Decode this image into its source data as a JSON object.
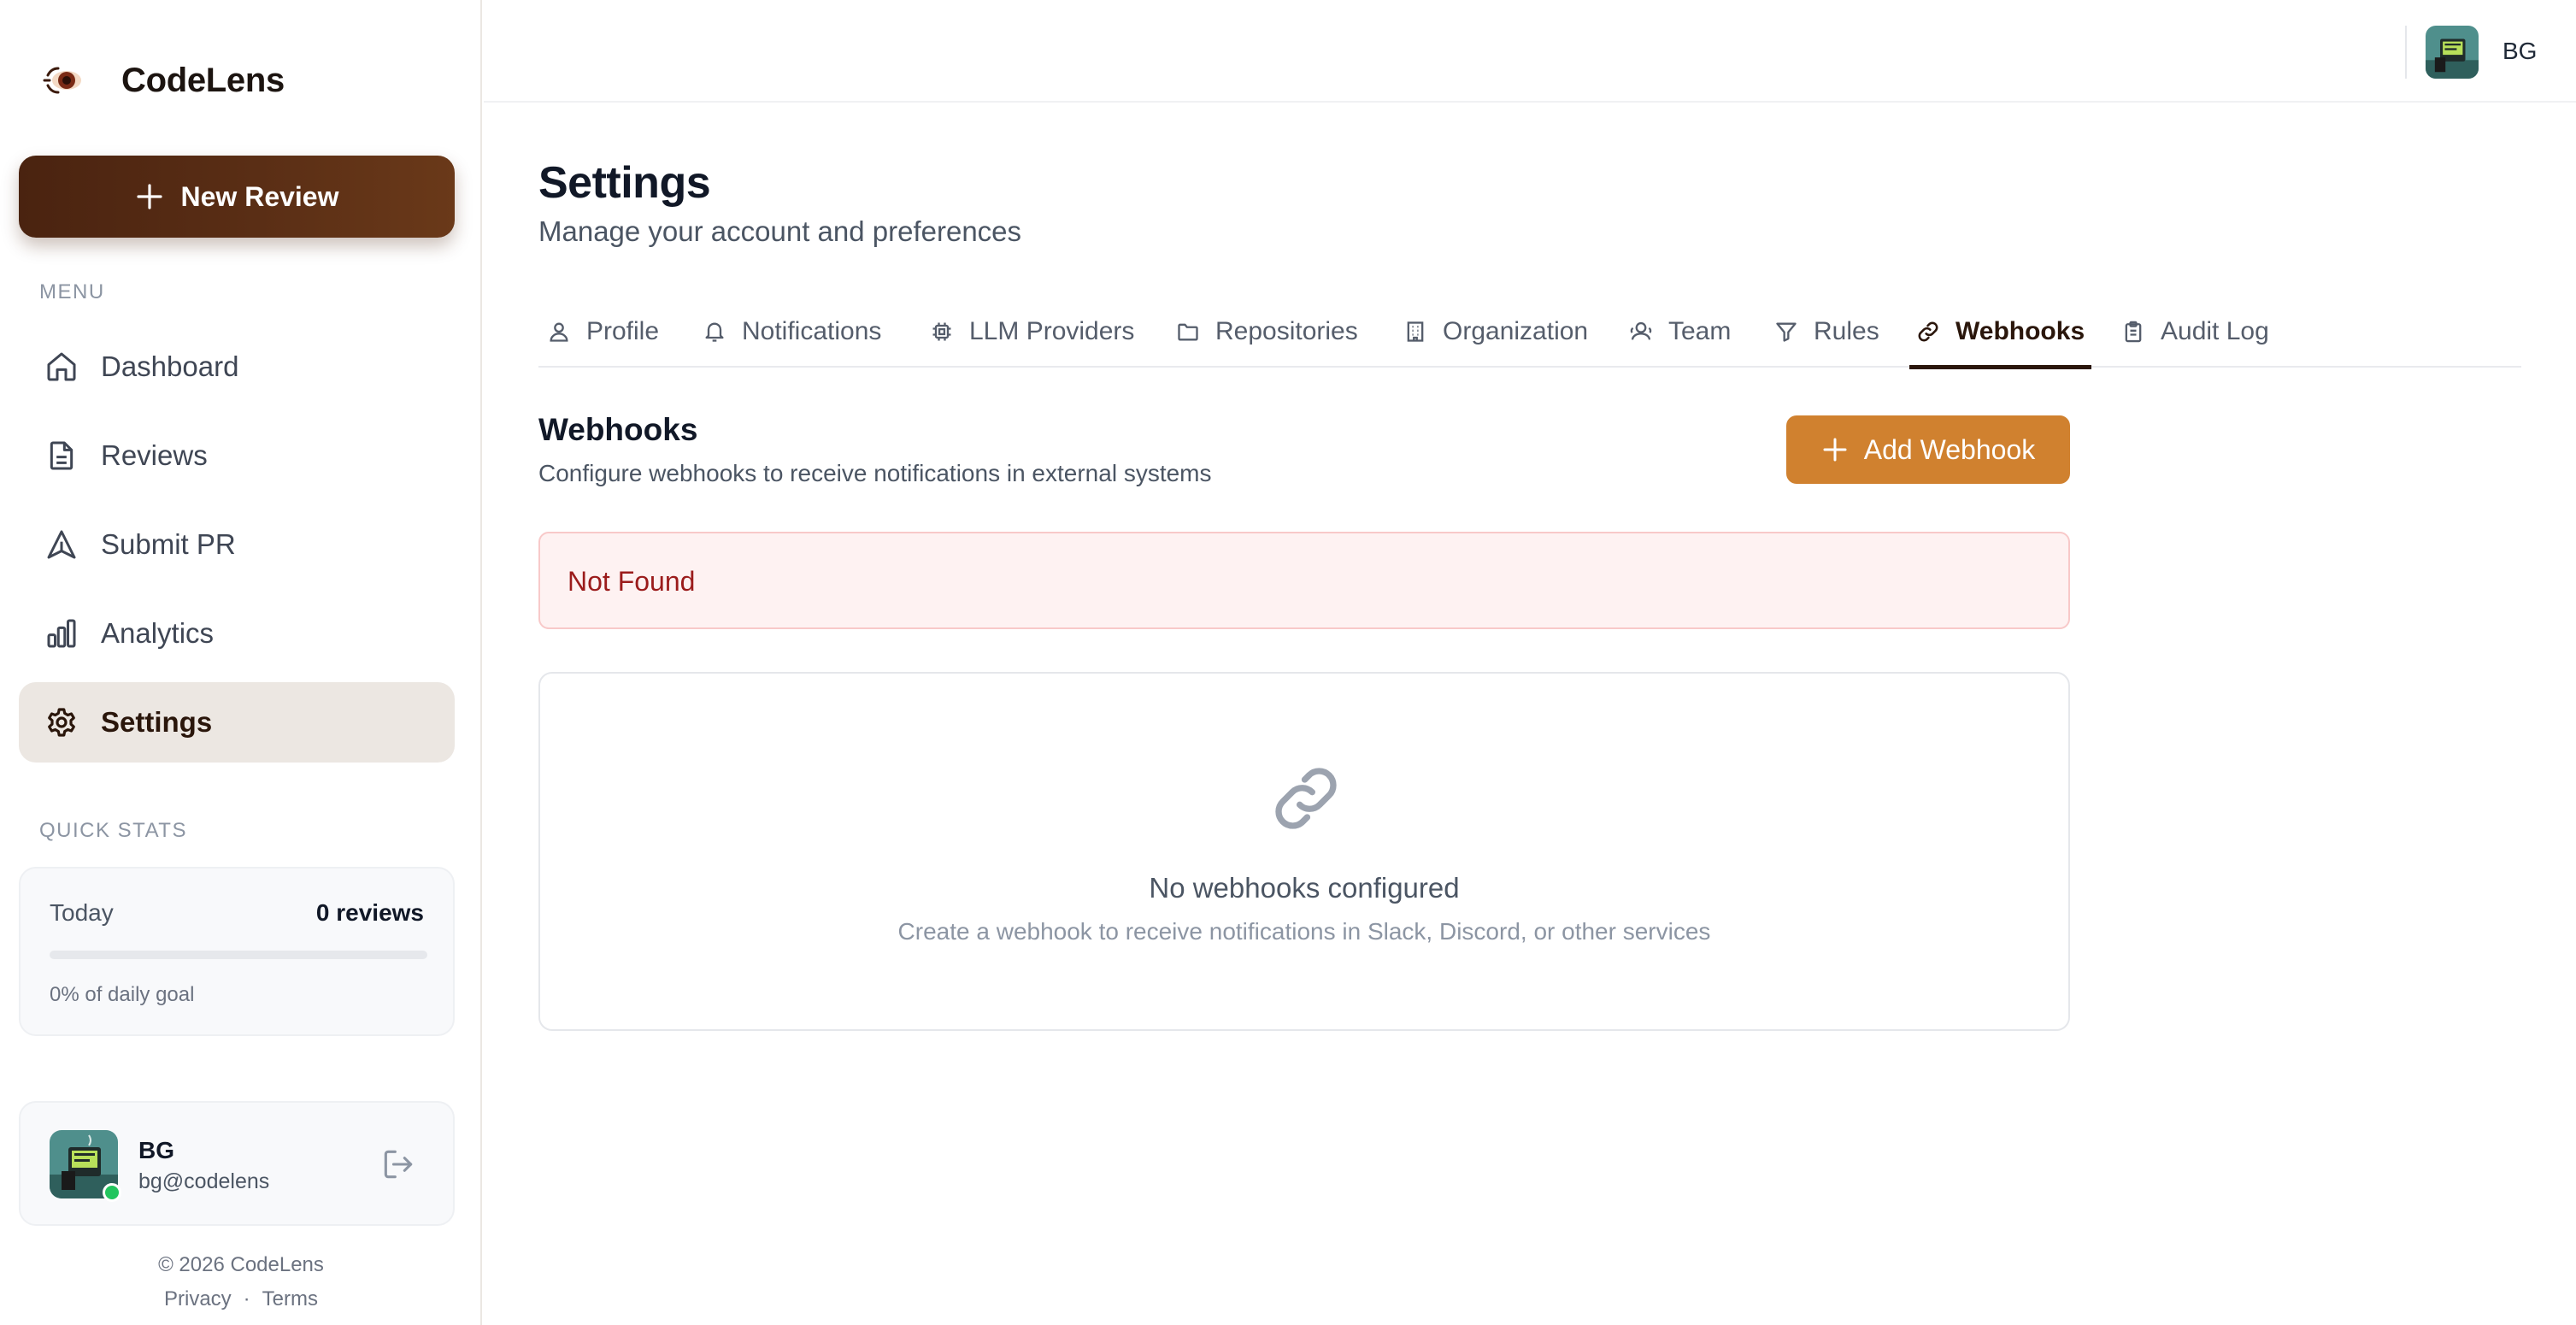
{
  "brand": {
    "name": "CodeLens",
    "logo_icon": "eye-logo-icon"
  },
  "sidebar": {
    "new_review_label": "New Review",
    "menu_label": "MENU",
    "items": [
      {
        "label": "Dashboard",
        "icon": "home-icon",
        "active": false
      },
      {
        "label": "Reviews",
        "icon": "document-icon",
        "active": false
      },
      {
        "label": "Submit PR",
        "icon": "send-icon",
        "active": false
      },
      {
        "label": "Analytics",
        "icon": "bar-chart-icon",
        "active": false
      },
      {
        "label": "Settings",
        "icon": "gear-icon",
        "active": true
      }
    ],
    "quick_stats_label": "QUICK STATS",
    "stats": {
      "period": "Today",
      "value": "0 reviews",
      "goal_text": "0% of daily goal",
      "progress": 0
    },
    "user": {
      "name": "BG",
      "email": "bg@codelens",
      "status": "online"
    },
    "footer": {
      "copyright": "© 2026 CodeLens",
      "privacy": "Privacy",
      "separator": "·",
      "terms": "Terms"
    }
  },
  "topbar": {
    "initials": "BG"
  },
  "page": {
    "title": "Settings",
    "subtitle": "Manage your account and preferences"
  },
  "tabs": [
    {
      "label": "Profile",
      "icon": "user-icon",
      "active": false
    },
    {
      "label": "Notifications",
      "icon": "bell-icon",
      "active": false
    },
    {
      "label": "LLM Providers",
      "icon": "chip-icon",
      "active": false
    },
    {
      "label": "Repositories",
      "icon": "folder-icon",
      "active": false
    },
    {
      "label": "Organization",
      "icon": "building-icon",
      "active": false
    },
    {
      "label": "Team",
      "icon": "users-icon",
      "active": false
    },
    {
      "label": "Rules",
      "icon": "filter-icon",
      "active": false
    },
    {
      "label": "Webhooks",
      "icon": "link-icon",
      "active": true
    },
    {
      "label": "Audit Log",
      "icon": "clipboard-icon",
      "active": false
    }
  ],
  "webhooks": {
    "title": "Webhooks",
    "description": "Configure webhooks to receive notifications in external systems",
    "add_label": "Add Webhook",
    "error": "Not Found",
    "empty_title": "No webhooks configured",
    "empty_description": "Create a webhook to receive notifications in Slack, Discord, or other services"
  },
  "colors": {
    "brand_dark": "#4a2310",
    "accent": "#d0812f",
    "active_nav_bg": "#ece7e2",
    "error_bg": "#fef2f2",
    "error_text": "#9b1c1c",
    "online": "#22c55e"
  }
}
